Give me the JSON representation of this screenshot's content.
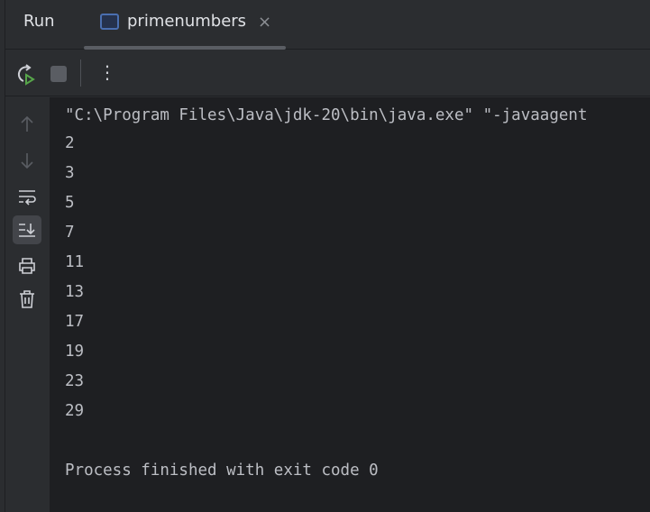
{
  "header": {
    "title": "Run",
    "tab": {
      "label": "primenumbers",
      "close": "×"
    }
  },
  "toolbar": {
    "more": "⋮"
  },
  "console": {
    "command": "\"C:\\Program Files\\Java\\jdk-20\\bin\\java.exe\" \"-javaagent",
    "output": [
      "2",
      "3",
      "5",
      "7",
      "11",
      "13",
      "17",
      "19",
      "23",
      "29"
    ],
    "exit": "Process finished with exit code 0"
  }
}
